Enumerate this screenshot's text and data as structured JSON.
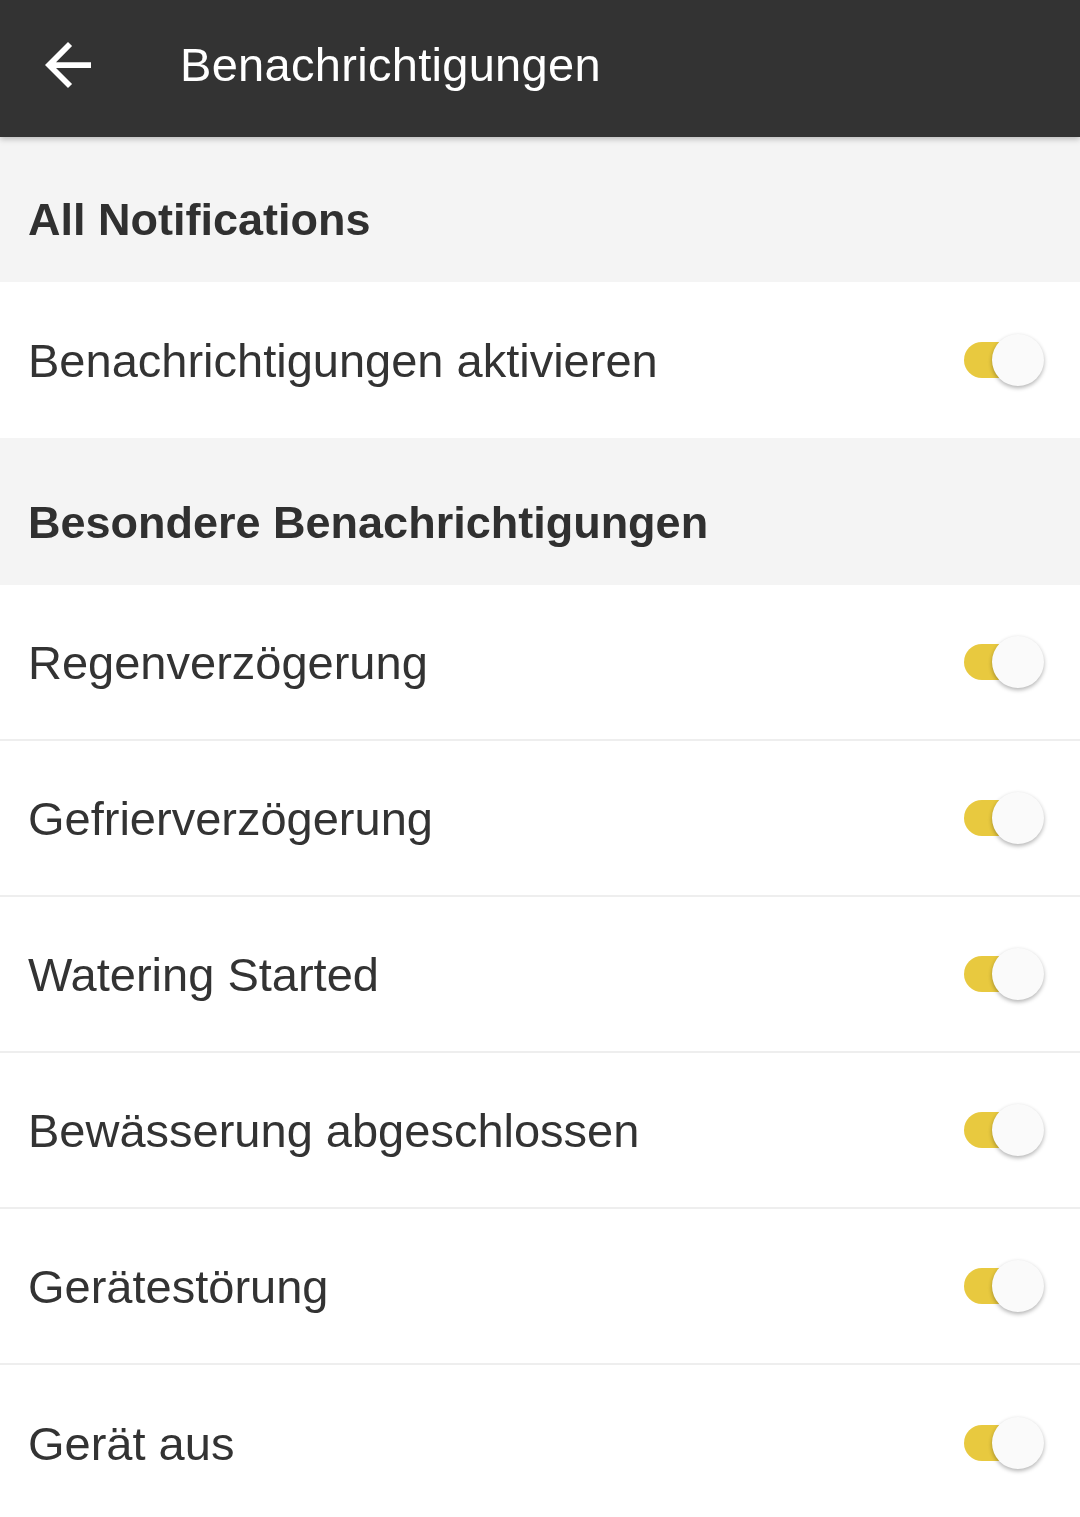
{
  "toolbar": {
    "title": "Benachrichtigungen"
  },
  "sections": [
    {
      "title": "All Notifications",
      "items": [
        {
          "label": "Benachrichtigungen aktivieren",
          "on": true
        }
      ]
    },
    {
      "title": "Besondere Benachrichtigungen",
      "items": [
        {
          "label": "Regenverzögerung",
          "on": true
        },
        {
          "label": "Gefrierverzögerung",
          "on": true
        },
        {
          "label": "Watering Started",
          "on": true
        },
        {
          "label": "Bewässerung abgeschlossen",
          "on": true
        },
        {
          "label": "Gerätestörung",
          "on": true
        },
        {
          "label": "Gerät aus",
          "on": true
        }
      ]
    }
  ]
}
